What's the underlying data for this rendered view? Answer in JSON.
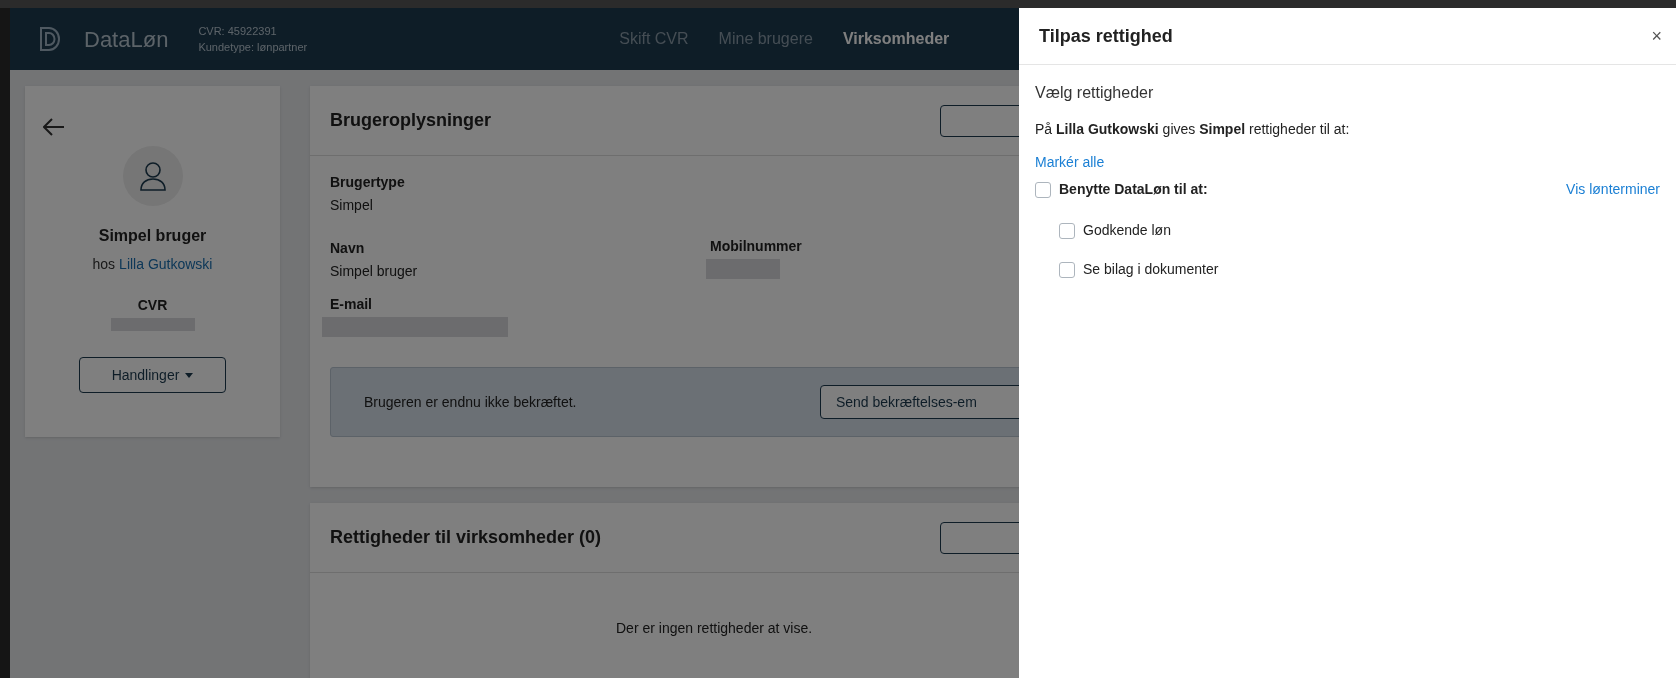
{
  "header": {
    "brand": "DataLøn",
    "cvr": "CVR: 45922391",
    "customer_type": "Kundetype: lønpartner",
    "nav": [
      {
        "label": "Skift CVR",
        "selected": false
      },
      {
        "label": "Mine brugere",
        "selected": false
      },
      {
        "label": "Virksomheder",
        "selected": true
      }
    ]
  },
  "profile": {
    "name": "Simpel bruger",
    "company_prefix": "hos",
    "company": "Lilla Gutkowski",
    "cvr_label": "CVR",
    "actions": "Handlinger"
  },
  "user_info": {
    "title": "Brugeroplysninger",
    "user_type": {
      "label": "Brugertype",
      "value": "Simpel"
    },
    "name": {
      "label": "Navn",
      "value": "Simpel bruger"
    },
    "mobile": {
      "label": "Mobilnummer"
    },
    "email": {
      "label": "E-mail"
    },
    "notice": "Brugeren er endnu ikke bekræftet.",
    "notice_button": "Send bekræftelses-em"
  },
  "rights": {
    "title": "Rettigheder til virksomheder (0)",
    "empty": "Der er ingen rettigheder at vise."
  },
  "drawer": {
    "title": "Tilpas rettighed",
    "close": "×",
    "heading": "Vælg rettigheder",
    "intro": "På **Lilla Gutkowski** gives **Simpel** rettigheder til at:",
    "select_all": "Markér alle",
    "group": {
      "label": "Benytte DataLøn til at:",
      "checked": false,
      "link": "Vis lønterminer",
      "children": [
        {
          "label": "Godkende løn",
          "checked": false
        },
        {
          "label": "Se bilag i dokumenter",
          "checked": false
        }
      ]
    }
  }
}
